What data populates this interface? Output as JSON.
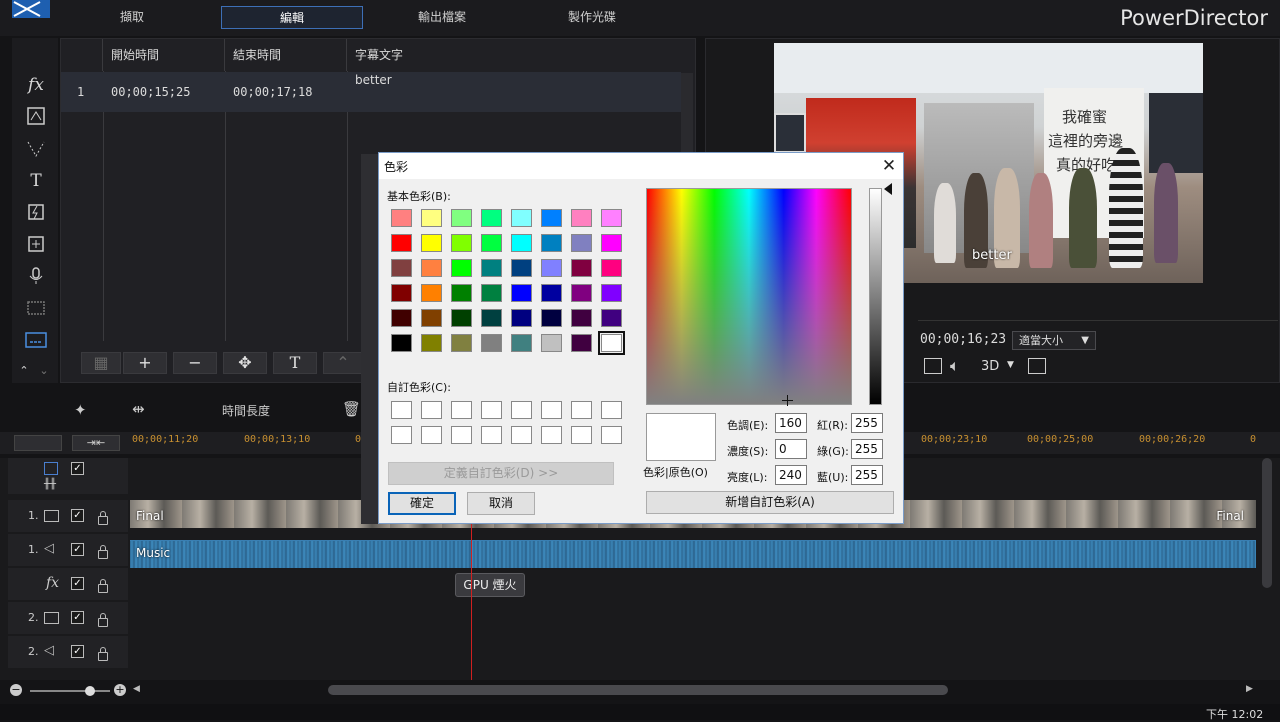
{
  "app": {
    "brand": "PowerDirector",
    "tabs": [
      {
        "label": "擷取"
      },
      {
        "label": "編輯"
      },
      {
        "label": "輸出檔案"
      },
      {
        "label": "製作光碟"
      }
    ]
  },
  "subtitle_table": {
    "headers": [
      "開始時間",
      "結束時間",
      "字幕文字"
    ],
    "rows": [
      {
        "index": "1",
        "start": "00;00;15;25",
        "end": "00;00;17;18",
        "text": "better"
      }
    ]
  },
  "preview": {
    "wall_text": [
      "我確蜜",
      "這裡的旁邊",
      "真的好吃"
    ],
    "overlay_text": "better",
    "timecode": "00;00;16;23",
    "fit_select": "適當大小",
    "mode_3d": "3D"
  },
  "mid_toolbar": {
    "duration_label": "時間長度"
  },
  "ruler": {
    "ticks": [
      "00;00;11;20",
      "00;00;13;10",
      "0",
      "00;00;23;10",
      "00;00;25;00",
      "00;00;26;20",
      "0"
    ]
  },
  "tracks": {
    "video_track_num": "1.",
    "audio_track_num": "1.",
    "video2_num": "2.",
    "audio2_num": "2.",
    "video_clip_left": "Final",
    "video_clip_right": "Final",
    "audio_clip": "Music",
    "fx_clip": "GPU 煙火"
  },
  "taskbar": {
    "clock": "下午 12:02"
  },
  "color_dialog": {
    "title": "色彩",
    "basic_colors_label": "基本色彩(B):",
    "custom_colors_label": "自訂色彩(C):",
    "define_custom_button": "定義自訂色彩(D) >>",
    "ok_button": "確定",
    "cancel_button": "取消",
    "color_solid_label": "色彩|原色(O)",
    "hue_label": "色調(E):",
    "hue_value": "160",
    "sat_label": "濃度(S):",
    "sat_value": "0",
    "lum_label": "亮度(L):",
    "lum_value": "240",
    "red_label": "紅(R):",
    "red_value": "255",
    "green_label": "綠(G):",
    "green_value": "255",
    "blue_label": "藍(U):",
    "blue_value": "255",
    "add_custom_button": "新增自訂色彩(A)",
    "basic_colors": [
      "#ff8080",
      "#ffff80",
      "#80ff80",
      "#00ff80",
      "#80ffff",
      "#0080ff",
      "#ff80c0",
      "#ff80ff",
      "#ff0000",
      "#ffff00",
      "#80ff00",
      "#00ff40",
      "#00ffff",
      "#0080c0",
      "#8080c0",
      "#ff00ff",
      "#804040",
      "#ff8040",
      "#00ff00",
      "#008080",
      "#004080",
      "#8080ff",
      "#800040",
      "#ff0080",
      "#800000",
      "#ff8000",
      "#008000",
      "#008040",
      "#0000ff",
      "#0000a0",
      "#800080",
      "#8000ff",
      "#400000",
      "#804000",
      "#004000",
      "#004040",
      "#000080",
      "#000040",
      "#400040",
      "#400080",
      "#000000",
      "#808000",
      "#808040",
      "#808080",
      "#408080",
      "#c0c0c0",
      "#400040",
      "#ffffff"
    ]
  }
}
